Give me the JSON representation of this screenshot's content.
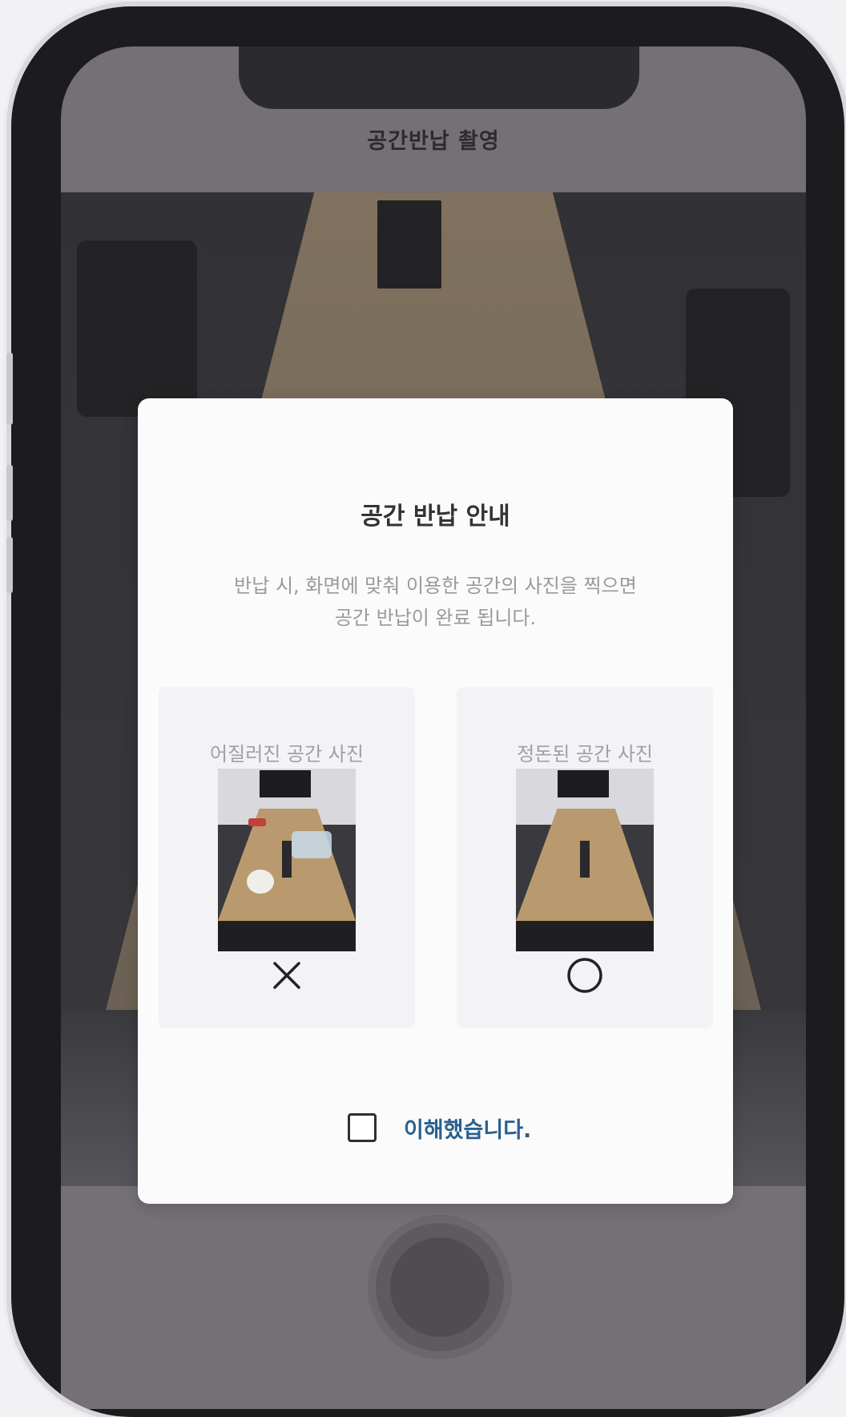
{
  "header": {
    "title": "공간반납 촬영"
  },
  "modal": {
    "title": "공간 반납 안내",
    "description_line1": "반납 시, 화면에 맞춰 이용한 공간의 사진을 찍으면",
    "description_line2": "공간 반납이 완료 됩니다.",
    "examples": [
      {
        "label": "어질러진 공간 사진",
        "mark": "x-mark-icon"
      },
      {
        "label": "정돈된 공간 사진",
        "mark": "circle-mark-icon"
      }
    ],
    "confirm_label": "이해했습니다.",
    "confirm_checked": false
  },
  "colors": {
    "accent_text": "#2a5f8f",
    "overlay": "#747075",
    "modal_bg": "#fbfbfb"
  }
}
